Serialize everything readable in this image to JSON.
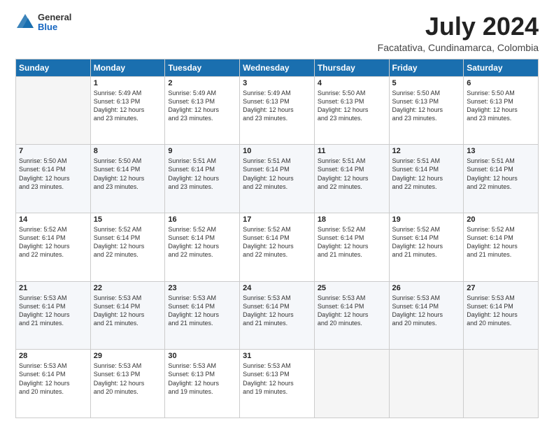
{
  "header": {
    "logo": {
      "line1": "General",
      "line2": "Blue"
    },
    "title": "July 2024",
    "location": "Facatativa, Cundinamarca, Colombia"
  },
  "weekdays": [
    "Sunday",
    "Monday",
    "Tuesday",
    "Wednesday",
    "Thursday",
    "Friday",
    "Saturday"
  ],
  "weeks": [
    [
      {
        "day": "",
        "info": ""
      },
      {
        "day": "1",
        "info": "Sunrise: 5:49 AM\nSunset: 6:13 PM\nDaylight: 12 hours\nand 23 minutes."
      },
      {
        "day": "2",
        "info": "Sunrise: 5:49 AM\nSunset: 6:13 PM\nDaylight: 12 hours\nand 23 minutes."
      },
      {
        "day": "3",
        "info": "Sunrise: 5:49 AM\nSunset: 6:13 PM\nDaylight: 12 hours\nand 23 minutes."
      },
      {
        "day": "4",
        "info": "Sunrise: 5:50 AM\nSunset: 6:13 PM\nDaylight: 12 hours\nand 23 minutes."
      },
      {
        "day": "5",
        "info": "Sunrise: 5:50 AM\nSunset: 6:13 PM\nDaylight: 12 hours\nand 23 minutes."
      },
      {
        "day": "6",
        "info": "Sunrise: 5:50 AM\nSunset: 6:13 PM\nDaylight: 12 hours\nand 23 minutes."
      }
    ],
    [
      {
        "day": "7",
        "info": "Sunrise: 5:50 AM\nSunset: 6:14 PM\nDaylight: 12 hours\nand 23 minutes."
      },
      {
        "day": "8",
        "info": "Sunrise: 5:50 AM\nSunset: 6:14 PM\nDaylight: 12 hours\nand 23 minutes."
      },
      {
        "day": "9",
        "info": "Sunrise: 5:51 AM\nSunset: 6:14 PM\nDaylight: 12 hours\nand 23 minutes."
      },
      {
        "day": "10",
        "info": "Sunrise: 5:51 AM\nSunset: 6:14 PM\nDaylight: 12 hours\nand 22 minutes."
      },
      {
        "day": "11",
        "info": "Sunrise: 5:51 AM\nSunset: 6:14 PM\nDaylight: 12 hours\nand 22 minutes."
      },
      {
        "day": "12",
        "info": "Sunrise: 5:51 AM\nSunset: 6:14 PM\nDaylight: 12 hours\nand 22 minutes."
      },
      {
        "day": "13",
        "info": "Sunrise: 5:51 AM\nSunset: 6:14 PM\nDaylight: 12 hours\nand 22 minutes."
      }
    ],
    [
      {
        "day": "14",
        "info": "Sunrise: 5:52 AM\nSunset: 6:14 PM\nDaylight: 12 hours\nand 22 minutes."
      },
      {
        "day": "15",
        "info": "Sunrise: 5:52 AM\nSunset: 6:14 PM\nDaylight: 12 hours\nand 22 minutes."
      },
      {
        "day": "16",
        "info": "Sunrise: 5:52 AM\nSunset: 6:14 PM\nDaylight: 12 hours\nand 22 minutes."
      },
      {
        "day": "17",
        "info": "Sunrise: 5:52 AM\nSunset: 6:14 PM\nDaylight: 12 hours\nand 22 minutes."
      },
      {
        "day": "18",
        "info": "Sunrise: 5:52 AM\nSunset: 6:14 PM\nDaylight: 12 hours\nand 21 minutes."
      },
      {
        "day": "19",
        "info": "Sunrise: 5:52 AM\nSunset: 6:14 PM\nDaylight: 12 hours\nand 21 minutes."
      },
      {
        "day": "20",
        "info": "Sunrise: 5:52 AM\nSunset: 6:14 PM\nDaylight: 12 hours\nand 21 minutes."
      }
    ],
    [
      {
        "day": "21",
        "info": "Sunrise: 5:53 AM\nSunset: 6:14 PM\nDaylight: 12 hours\nand 21 minutes."
      },
      {
        "day": "22",
        "info": "Sunrise: 5:53 AM\nSunset: 6:14 PM\nDaylight: 12 hours\nand 21 minutes."
      },
      {
        "day": "23",
        "info": "Sunrise: 5:53 AM\nSunset: 6:14 PM\nDaylight: 12 hours\nand 21 minutes."
      },
      {
        "day": "24",
        "info": "Sunrise: 5:53 AM\nSunset: 6:14 PM\nDaylight: 12 hours\nand 21 minutes."
      },
      {
        "day": "25",
        "info": "Sunrise: 5:53 AM\nSunset: 6:14 PM\nDaylight: 12 hours\nand 20 minutes."
      },
      {
        "day": "26",
        "info": "Sunrise: 5:53 AM\nSunset: 6:14 PM\nDaylight: 12 hours\nand 20 minutes."
      },
      {
        "day": "27",
        "info": "Sunrise: 5:53 AM\nSunset: 6:14 PM\nDaylight: 12 hours\nand 20 minutes."
      }
    ],
    [
      {
        "day": "28",
        "info": "Sunrise: 5:53 AM\nSunset: 6:14 PM\nDaylight: 12 hours\nand 20 minutes."
      },
      {
        "day": "29",
        "info": "Sunrise: 5:53 AM\nSunset: 6:13 PM\nDaylight: 12 hours\nand 20 minutes."
      },
      {
        "day": "30",
        "info": "Sunrise: 5:53 AM\nSunset: 6:13 PM\nDaylight: 12 hours\nand 19 minutes."
      },
      {
        "day": "31",
        "info": "Sunrise: 5:53 AM\nSunset: 6:13 PM\nDaylight: 12 hours\nand 19 minutes."
      },
      {
        "day": "",
        "info": ""
      },
      {
        "day": "",
        "info": ""
      },
      {
        "day": "",
        "info": ""
      }
    ]
  ]
}
